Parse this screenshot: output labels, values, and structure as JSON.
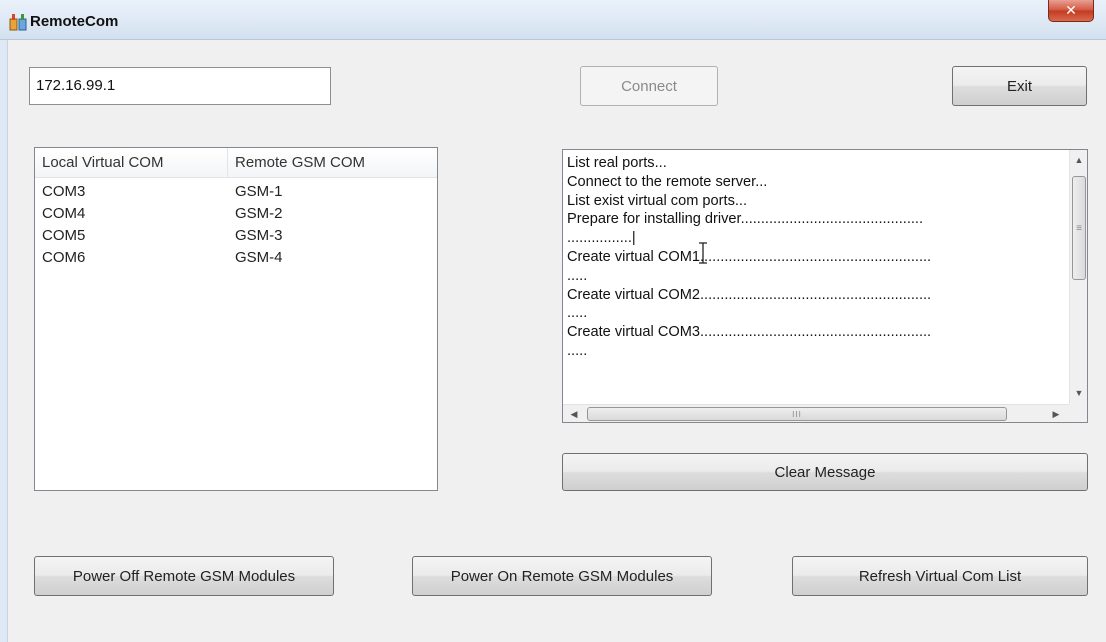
{
  "window": {
    "title": "RemoteCom",
    "close_glyph": "✕",
    "icons": {
      "app": "app-icon",
      "close": "close-icon"
    }
  },
  "connection": {
    "ip_value": "172.16.99.1",
    "connect_label": "Connect",
    "connect_enabled": false,
    "exit_label": "Exit"
  },
  "com_list": {
    "headers": [
      "Local Virtual COM",
      "Remote GSM COM"
    ],
    "rows": [
      [
        "COM3",
        "GSM-1"
      ],
      [
        "COM4",
        "GSM-2"
      ],
      [
        "COM5",
        "GSM-3"
      ],
      [
        "COM6",
        "GSM-4"
      ]
    ]
  },
  "messages": {
    "lines": [
      "List real ports...",
      "Connect to the remote server...",
      "List exist virtual com ports...",
      "Prepare for installing driver.............................................",
      "................|",
      "Create virtual COM1.........................................................",
      ".....",
      "Create virtual COM2.........................................................",
      ".....",
      "Create virtual COM3.........................................................",
      "....."
    ],
    "scroll_glyphs": {
      "up": "▲",
      "down": "▼",
      "left": "◀",
      "right": "▶",
      "grip_v": "≡",
      "grip_h": "III"
    },
    "clear_label": "Clear Message"
  },
  "actions": {
    "power_off_label": "Power Off Remote GSM Modules",
    "power_on_label": "Power On Remote GSM Modules",
    "refresh_label": "Refresh Virtual Com List"
  },
  "colors": {
    "window_bg": "#f0f0f0",
    "titlebar": "#dfe9f5",
    "close_button": "#c23a1f",
    "button_border": "#707070",
    "disabled_text": "#8a8a8a"
  }
}
